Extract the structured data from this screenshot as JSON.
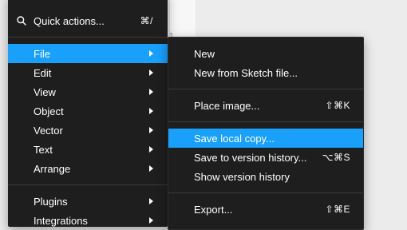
{
  "canvas": {
    "mark": "1"
  },
  "menu": {
    "quick_actions": {
      "label": "Quick actions...",
      "shortcut": "⌘/"
    },
    "items": [
      {
        "label": "File"
      },
      {
        "label": "Edit"
      },
      {
        "label": "View"
      },
      {
        "label": "Object"
      },
      {
        "label": "Vector"
      },
      {
        "label": "Text"
      },
      {
        "label": "Arrange"
      },
      {
        "label": "Plugins"
      },
      {
        "label": "Integrations"
      }
    ]
  },
  "submenu": {
    "items": [
      {
        "label": "New",
        "shortcut": ""
      },
      {
        "label": "New from Sketch file...",
        "shortcut": ""
      },
      {
        "label": "Place image...",
        "shortcut": "⇧⌘K"
      },
      {
        "label": "Save local copy...",
        "shortcut": ""
      },
      {
        "label": "Save to version history...",
        "shortcut": "⌥⌘S"
      },
      {
        "label": "Show version history",
        "shortcut": ""
      },
      {
        "label": "Export...",
        "shortcut": "⇧⌘E"
      }
    ]
  },
  "colors": {
    "menu_bg": "#1e1e1e",
    "highlight": "#18a0fb",
    "divider": "#3a3a3a",
    "text": "#ffffff"
  }
}
